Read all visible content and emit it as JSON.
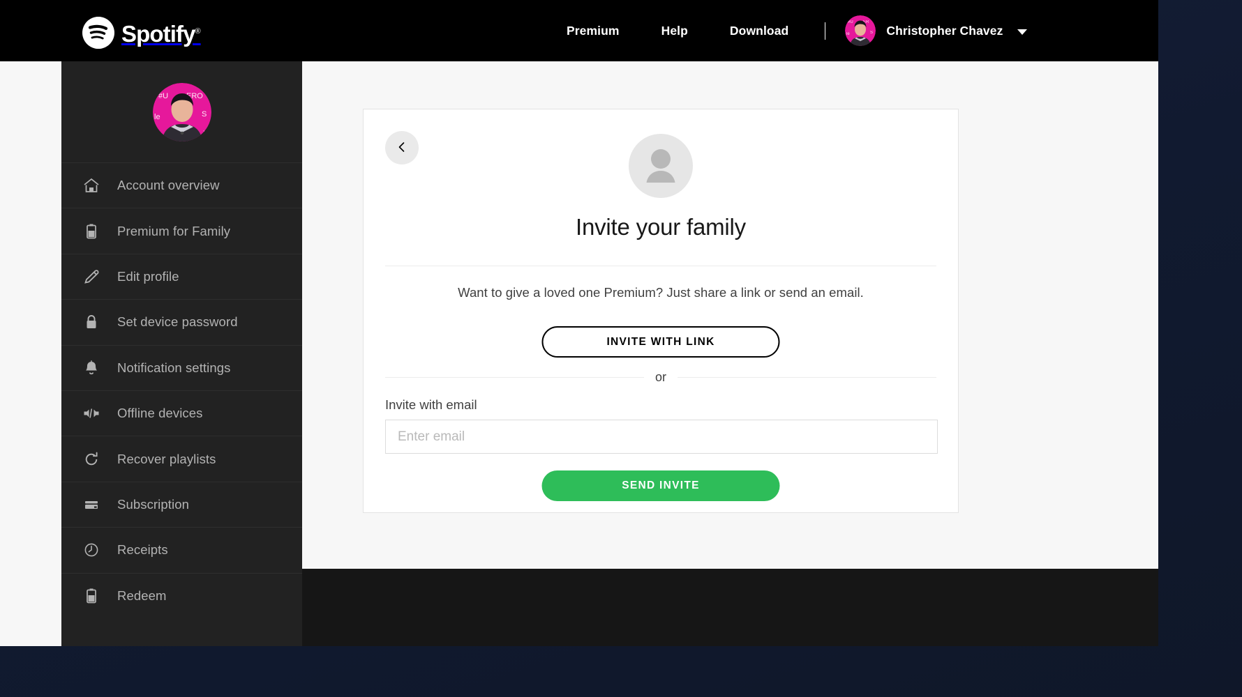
{
  "brand": {
    "name": "Spotify",
    "registered_mark": "®",
    "logo_icon": "spotify-logo-icon",
    "accent_green": "#2ebd59",
    "header_bg": "#000000",
    "sidebar_bg": "#222222",
    "avatar_bg": "#e6189b"
  },
  "header": {
    "nav": [
      {
        "label": "Premium",
        "name": "nav-premium"
      },
      {
        "label": "Help",
        "name": "nav-help"
      },
      {
        "label": "Download",
        "name": "nav-download"
      }
    ],
    "user": {
      "name": "Christopher Chavez",
      "avatar_icon": "user-avatar-photo",
      "caret_icon": "chevron-down-icon"
    }
  },
  "sidebar": {
    "profile_avatar_icon": "user-avatar-photo",
    "items": [
      {
        "label": "Account overview",
        "icon": "home-icon"
      },
      {
        "label": "Premium for Family",
        "icon": "clipboard-icon"
      },
      {
        "label": "Edit profile",
        "icon": "pencil-icon"
      },
      {
        "label": "Set device password",
        "icon": "lock-icon"
      },
      {
        "label": "Notification settings",
        "icon": "bell-icon"
      },
      {
        "label": "Offline devices",
        "icon": "offline-devices-icon"
      },
      {
        "label": "Recover playlists",
        "icon": "refresh-icon"
      },
      {
        "label": "Subscription",
        "icon": "credit-card-icon"
      },
      {
        "label": "Receipts",
        "icon": "clock-icon"
      },
      {
        "label": "Redeem",
        "icon": "clipboard-icon"
      }
    ]
  },
  "card": {
    "back_icon": "chevron-left-icon",
    "hero_icon": "person-placeholder-icon",
    "title": "Invite your family",
    "lead": "Want to give a loved one Premium? Just share a link or send an email.",
    "invite_link_button": "INVITE WITH LINK",
    "or_text": "or",
    "email_label": "Invite with email",
    "email_value": "",
    "email_placeholder": "Enter email",
    "send_button": "SEND INVITE"
  }
}
